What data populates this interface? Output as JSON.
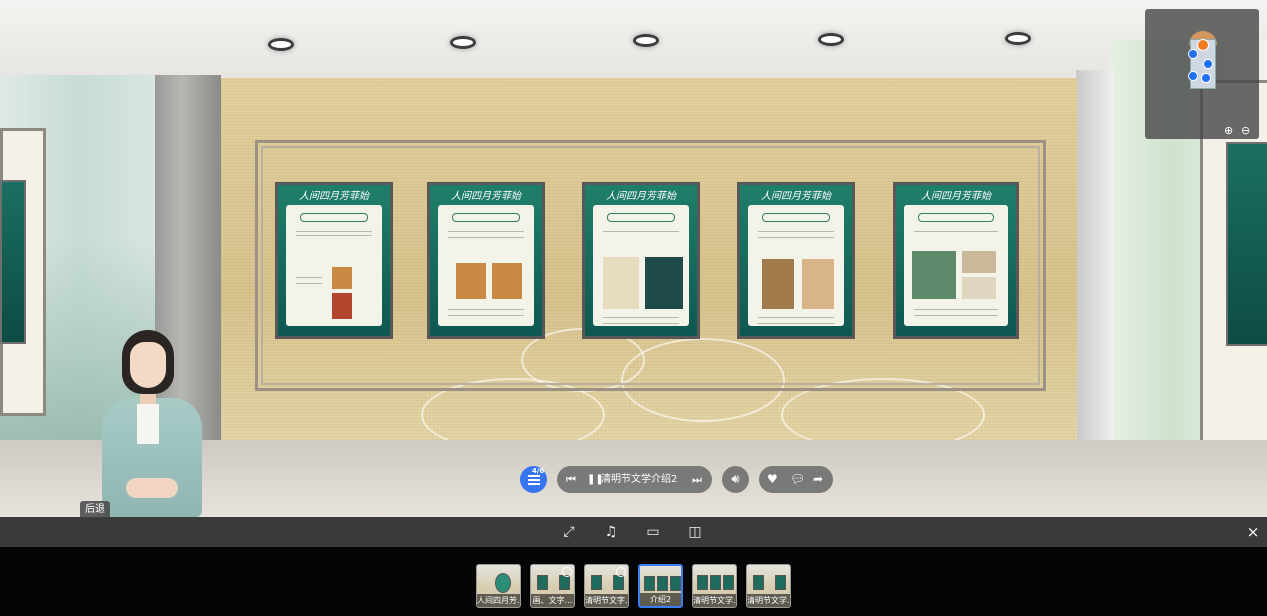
{
  "hub": {
    "count": "4/6"
  },
  "player": {
    "prev_icon": "skip-previous-icon",
    "pause_icon": "pause-icon",
    "next_icon": "skip-next-icon",
    "track_title": "清明节文学介绍2"
  },
  "volume": {
    "icon": "volume-icon"
  },
  "social": {
    "like_icon": "heart-icon",
    "comment_icon": "comment-icon",
    "share_icon": "share-icon"
  },
  "avatar": {
    "back_label": "后退"
  },
  "minimap": {
    "zoom_in": "zoom-in-icon",
    "zoom_out": "zoom-out-icon"
  },
  "toolbar": {
    "items": [
      "fullscreen-icon",
      "music-icon",
      "vr-glasses-icon",
      "gyroscope-icon"
    ],
    "close": "×"
  },
  "posters": {
    "title": "人间四月芳菲始"
  },
  "thumbnails": [
    {
      "caption": "人间四月芳..."
    },
    {
      "caption": "画、文字..."
    },
    {
      "caption": "清明节文字..."
    },
    {
      "caption": "介绍2"
    },
    {
      "caption": "清明节文学..."
    },
    {
      "caption": "清明节文学..."
    }
  ],
  "colors": {
    "accent": "#3575f0",
    "panel": "#696969",
    "toolbar": "#3a3a3a",
    "poster_green": "#1f7f6a"
  }
}
